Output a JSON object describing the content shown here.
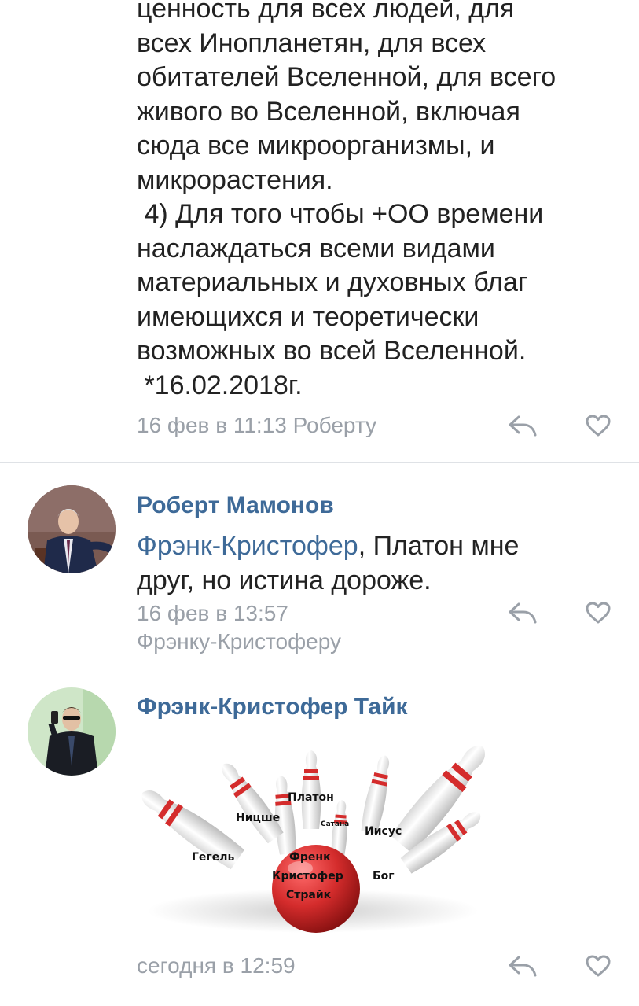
{
  "colors": {
    "accent": "#3e6a98",
    "meta": "#9aa0a8",
    "divider": "#dfe2e6",
    "pin_red": "#d42c2c"
  },
  "comments": [
    {
      "text": "ценность для всех людей, для\nвсех Инопланетян, для всех\nобитателей Вселенной, для всего\nживого во Вселенной, включая\nсюда все микроорганизмы, и\nмикрорастения.\n 4) Для того чтобы +ОО времени\nнаслаждаться всеми видами\nматериальных и духовных благ\nимеющихся и теоретически\nвозможных во всей Вселенной.\n *16.02.2018г.",
      "meta": "16 фев в 11:13 Роберту",
      "reply_icon": "reply-icon",
      "like_icon": "heart-icon"
    },
    {
      "author": "Роберт Мамонов",
      "mention": "Фрэнк-Кристофер",
      "text": ", Платон мне\nдруг, но истина дороже.",
      "meta": "16 фев в 13:57\nФрэнку-Кристоферу",
      "avatar_icon": "user-avatar"
    },
    {
      "author": "Фрэнк-Кристофер Тайк",
      "attachment": {
        "labels": {
          "plato": "Платон",
          "nietzsche": "Ницше",
          "satan": "Сатана",
          "jesus": "Иисус",
          "hegel": "Гегель",
          "ball_1": "Френк",
          "ball_2": "Кристофер",
          "ball_3": "Страйк",
          "god": "Бог"
        }
      },
      "meta": "сегодня в 12:59",
      "avatar_icon": "user-avatar"
    }
  ]
}
